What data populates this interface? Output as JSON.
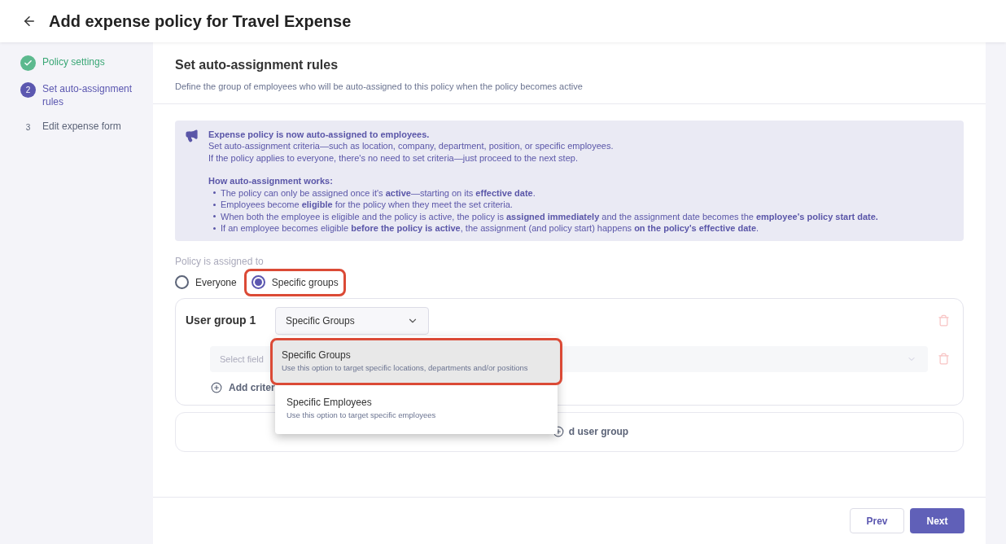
{
  "header": {
    "title": "Add expense policy for Travel Expense"
  },
  "steps": [
    {
      "label": "Policy settings",
      "completed": true,
      "current": false
    },
    {
      "number": "2",
      "label": "Set auto-assignment rules",
      "completed": false,
      "current": true
    },
    {
      "number": "3",
      "label": "Edit expense form",
      "completed": false,
      "current": false
    }
  ],
  "section": {
    "title": "Set auto-assignment rules",
    "subtitle": "Define the group of employees who will be auto-assigned to this policy when the policy becomes active"
  },
  "notice": {
    "title": "Expense policy is now auto-assigned to employees.",
    "lines": [
      "Set auto-assignment criteria—such as location, company, department, position, or specific employees.",
      "If the policy applies to everyone, there's no need to set criteria—just proceed to the next step."
    ],
    "subtitle": "How auto-assignment works:",
    "bullets": [
      "The policy can only be assigned once it's **active**—starting on its **effective date**.",
      "Employees become **eligible** for the policy when they meet the set criteria.",
      "When both the employee is eligible and the policy is active, the policy is **assigned immediately** and the assignment date becomes the **employee's policy start date.**",
      "If an employee becomes eligible **before the policy is active**, the assignment (and policy start) happens **on the policy's effective date**."
    ]
  },
  "assignment": {
    "label": "Policy is assigned to",
    "options": [
      {
        "label": "Everyone",
        "selected": false,
        "highlighted": false
      },
      {
        "label": "Specific groups",
        "selected": true,
        "highlighted": true
      }
    ]
  },
  "user_groups": [
    {
      "title": "User group 1",
      "type_select": {
        "value": "Specific Groups",
        "expanded": true,
        "options": [
          {
            "title": "Specific Groups",
            "description": "Use this option to target specific locations, departments and/or positions",
            "selected": true,
            "highlighted": true
          },
          {
            "title": "Specific Employees",
            "description": "Use this option to target specific employees",
            "selected": false,
            "highlighted": false
          }
        ]
      },
      "criteria": [
        {
          "placeholder": "Select field"
        }
      ],
      "add_criteria": "Add criter"
    }
  ],
  "add_user_group": "d user group",
  "footer": {
    "buttons": [
      {
        "label": "Prev",
        "kind": "secondary"
      },
      {
        "label": "Next",
        "kind": "primary"
      }
    ]
  }
}
